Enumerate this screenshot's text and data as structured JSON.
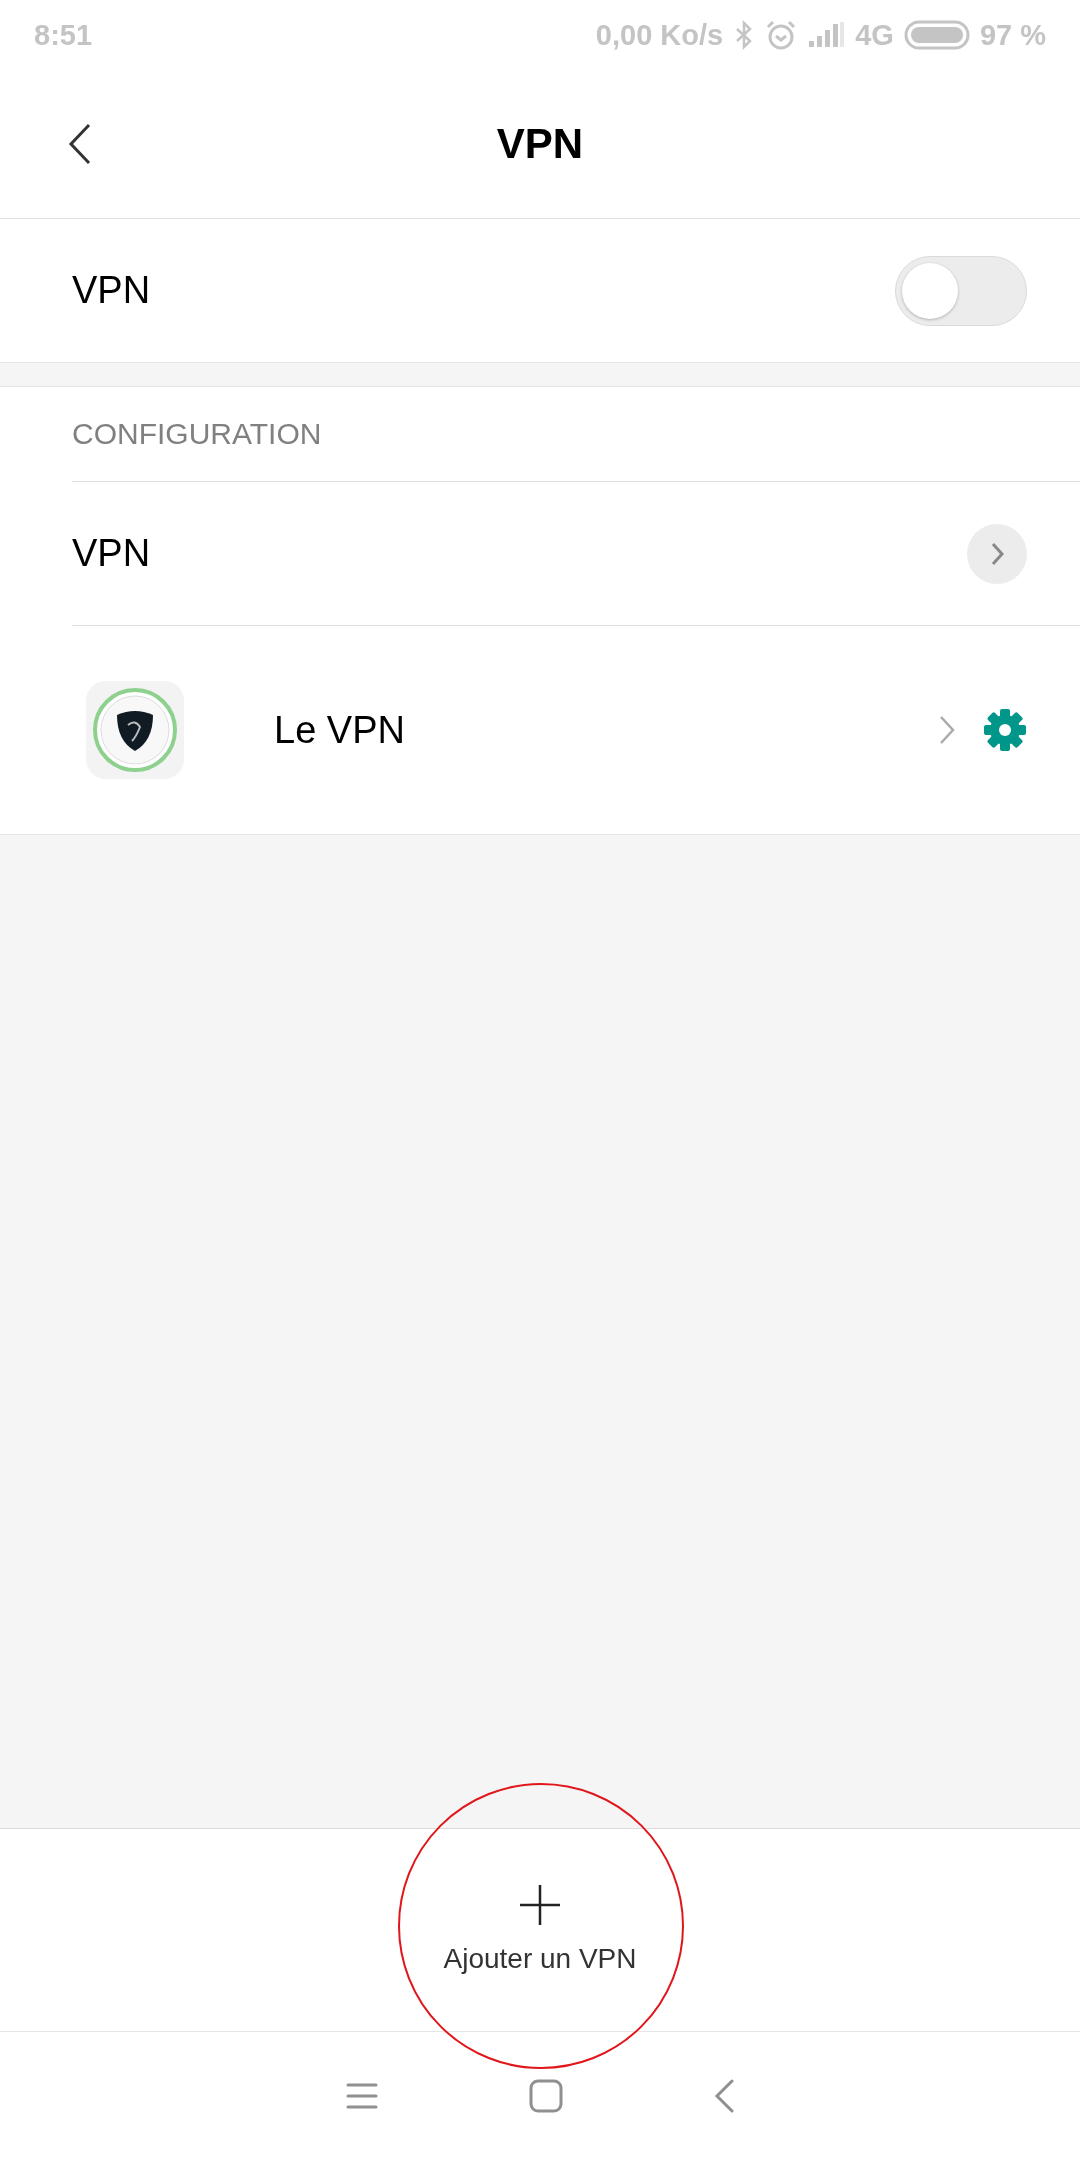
{
  "status_bar": {
    "time": "8:51",
    "speed": "0,00 Ko/s",
    "network": "4G",
    "battery": "97 %"
  },
  "header": {
    "title": "VPN"
  },
  "vpn_switch": {
    "label": "VPN",
    "on": false
  },
  "section": {
    "title": "CONFIGURATION",
    "items": [
      {
        "kind": "link",
        "label": "VPN"
      },
      {
        "kind": "app",
        "label": "Le VPN"
      }
    ]
  },
  "add_button": {
    "label": "Ajouter un VPN",
    "highlighted": true
  }
}
